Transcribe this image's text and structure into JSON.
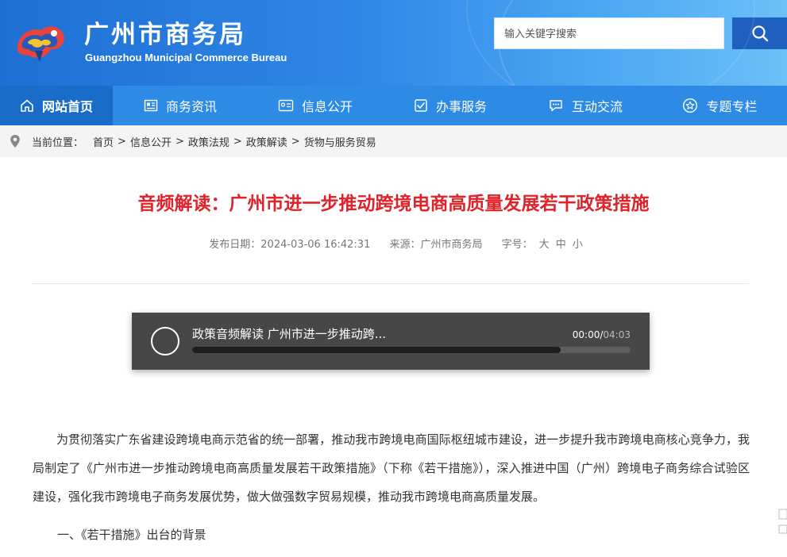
{
  "header": {
    "title": "广州市商务局",
    "subtitle": "Guangzhou Municipal Commerce Bureau",
    "search_placeholder": "输入关键字搜索"
  },
  "nav": {
    "items": [
      {
        "label": "网站首页",
        "icon": "home-icon",
        "active": true
      },
      {
        "label": "商务资讯",
        "icon": "news-icon",
        "active": false
      },
      {
        "label": "信息公开",
        "icon": "info-card-icon",
        "active": false
      },
      {
        "label": "办事服务",
        "icon": "checkbox-icon",
        "active": false
      },
      {
        "label": "互动交流",
        "icon": "chat-icon",
        "active": false
      },
      {
        "label": "专题专栏",
        "icon": "star-icon",
        "active": false
      }
    ]
  },
  "breadcrumb": {
    "label": "当前位置：",
    "items": [
      "首页",
      "信息公开",
      "政策法规",
      "政策解读",
      "货物与服务贸易"
    ],
    "separator": ">"
  },
  "article": {
    "title": "音频解读：广州市进一步推动跨境电商高质量发展若干政策措施",
    "date": "发布日期：2024-03-06 16:42:31",
    "source": "来源：广州市商务局",
    "font_size_label": "字号：",
    "font_sizes": [
      "大",
      "中",
      "小"
    ]
  },
  "player": {
    "title": "政策音频解读 广州市进一步推动跨...",
    "current_time": "00:00",
    "time_separator": "/",
    "duration": "04:03",
    "track_dark_fraction": 0.84
  },
  "body": {
    "paragraph1": "为贯彻落实广东省建设跨境电商示范省的统一部署，推动我市跨境电商国际枢纽城市建设，进一步提升我市跨境电商核心竞争力，我局制定了《广州市进一步推动跨境电商高质量发展若干政策措施》（下称《若干措施》），深入推进中国（广州）跨境电子商务综合试验区建设，强化我市跨境电子商务发展优势，做大做强数字贸易规模，推动我市跨境电商高质量发展。",
    "section1": "一、《若干措施》出台的背景"
  },
  "colors": {
    "header_blue": "#2e86e6",
    "nav_blue": "#2d8ae5",
    "nav_active": "#1a6cc9",
    "title_red": "#e0232a",
    "player_bg": "#474747"
  }
}
